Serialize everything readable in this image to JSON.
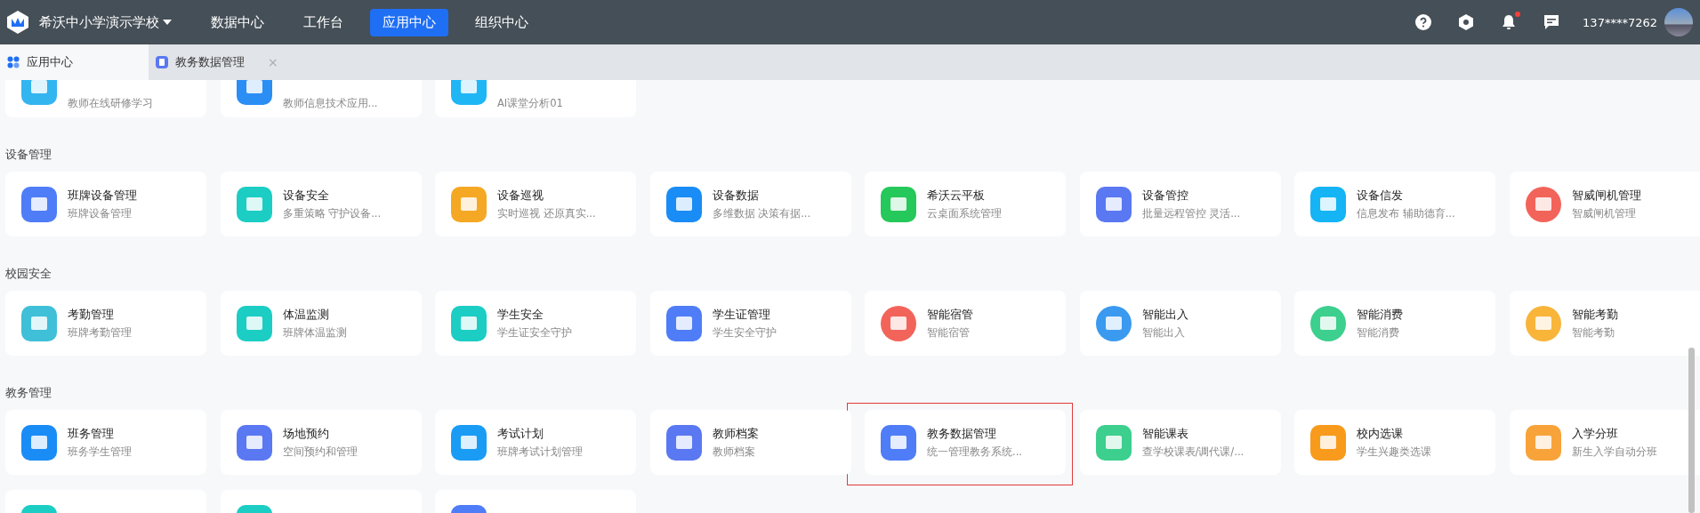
{
  "topbar": {
    "school": "希沃中小学演示学校",
    "nav": [
      {
        "label": "数据中心",
        "selected": false
      },
      {
        "label": "工作台",
        "selected": false
      },
      {
        "label": "应用中心",
        "selected": true
      },
      {
        "label": "组织中心",
        "selected": false
      }
    ],
    "notification_dot": true,
    "user": "137****7262"
  },
  "tabs": [
    {
      "label": "应用中心",
      "selected": true
    },
    {
      "label": "教务数据管理",
      "selected": false,
      "close": "×"
    }
  ],
  "partial_row": [
    {
      "subtitle": "教师在线研修学习",
      "color": "#33b5f0"
    },
    {
      "subtitle": "教师信息技术应用...",
      "color": "#2a8ef5"
    },
    {
      "subtitle": "AI课堂分析01",
      "color": "#1fb6f5"
    }
  ],
  "sections": [
    {
      "title": "设备管理",
      "apps": [
        {
          "title": "班牌设备管理",
          "subtitle": "班牌设备管理",
          "color": "#4f7df7",
          "kind": "square",
          "highlighted": false
        },
        {
          "title": "设备安全",
          "subtitle": "多重策略 守护设备...",
          "color": "#1ccdc4",
          "kind": "square",
          "highlighted": false
        },
        {
          "title": "设备巡视",
          "subtitle": "实时巡视 还原真实...",
          "color": "#f5a823",
          "kind": "square",
          "highlighted": false
        },
        {
          "title": "设备数据",
          "subtitle": "多维数据 决策有据...",
          "color": "#1a8cf5",
          "kind": "square",
          "highlighted": false
        },
        {
          "title": "希沃云平板",
          "subtitle": "云桌面系统管理",
          "color": "#25c85a",
          "kind": "square",
          "highlighted": false
        },
        {
          "title": "设备管控",
          "subtitle": "批量远程管控 灵活...",
          "color": "#5a78f2",
          "kind": "square",
          "highlighted": false
        },
        {
          "title": "设备信发",
          "subtitle": "信息发布 辅助德育...",
          "color": "#14b4f5",
          "kind": "square",
          "highlighted": false
        },
        {
          "title": "智威闸机管理",
          "subtitle": "智威闸机管理",
          "color": "#f2645a",
          "kind": "circle",
          "highlighted": false
        }
      ]
    },
    {
      "title": "校园安全",
      "apps": [
        {
          "title": "考勤管理",
          "subtitle": "班牌考勤管理",
          "color": "#3fbfd8",
          "kind": "square",
          "highlighted": false
        },
        {
          "title": "体温监测",
          "subtitle": "班牌体温监测",
          "color": "#1ccdc4",
          "kind": "square",
          "highlighted": false
        },
        {
          "title": "学生安全",
          "subtitle": "学生证安全守护",
          "color": "#1ccdc4",
          "kind": "square",
          "highlighted": false
        },
        {
          "title": "学生证管理",
          "subtitle": "学生安全守护",
          "color": "#4f7df7",
          "kind": "square",
          "highlighted": false
        },
        {
          "title": "智能宿管",
          "subtitle": "智能宿管",
          "color": "#f2645a",
          "kind": "circle",
          "highlighted": false
        },
        {
          "title": "智能出入",
          "subtitle": "智能出入",
          "color": "#3a9af0",
          "kind": "circle",
          "highlighted": false
        },
        {
          "title": "智能消费",
          "subtitle": "智能消费",
          "color": "#3ccf8e",
          "kind": "circle",
          "highlighted": false
        },
        {
          "title": "智能考勤",
          "subtitle": "智能考勤",
          "color": "#f8b53a",
          "kind": "circle",
          "highlighted": false
        }
      ]
    },
    {
      "title": "教务管理",
      "apps": [
        {
          "title": "班务管理",
          "subtitle": "班务学生管理",
          "color": "#1a8cf5",
          "kind": "square",
          "highlighted": false
        },
        {
          "title": "场地预约",
          "subtitle": "空间预约和管理",
          "color": "#5a78f2",
          "kind": "square",
          "highlighted": false
        },
        {
          "title": "考试计划",
          "subtitle": "班牌考试计划管理",
          "color": "#1a9cf5",
          "kind": "square",
          "highlighted": false
        },
        {
          "title": "教师档案",
          "subtitle": "教师档案",
          "color": "#5a78f2",
          "kind": "square",
          "highlighted": false
        },
        {
          "title": "教务数据管理",
          "subtitle": "统一管理教务系统...",
          "color": "#4f7df7",
          "kind": "square",
          "highlighted": true
        },
        {
          "title": "智能课表",
          "subtitle": "查学校课表/调代课/...",
          "color": "#3ccf8e",
          "kind": "square",
          "highlighted": false
        },
        {
          "title": "校内选课",
          "subtitle": "学生兴趣类选课",
          "color": "#f89a1c",
          "kind": "square",
          "highlighted": false
        },
        {
          "title": "入学分班",
          "subtitle": "新生入学自动分班",
          "color": "#f8a33a",
          "kind": "square",
          "highlighted": false
        }
      ]
    }
  ],
  "cut_row": [
    {
      "color": "#1ccdc4"
    },
    {
      "color": "#1ccdc4"
    },
    {
      "color": "#4f7df7"
    }
  ]
}
